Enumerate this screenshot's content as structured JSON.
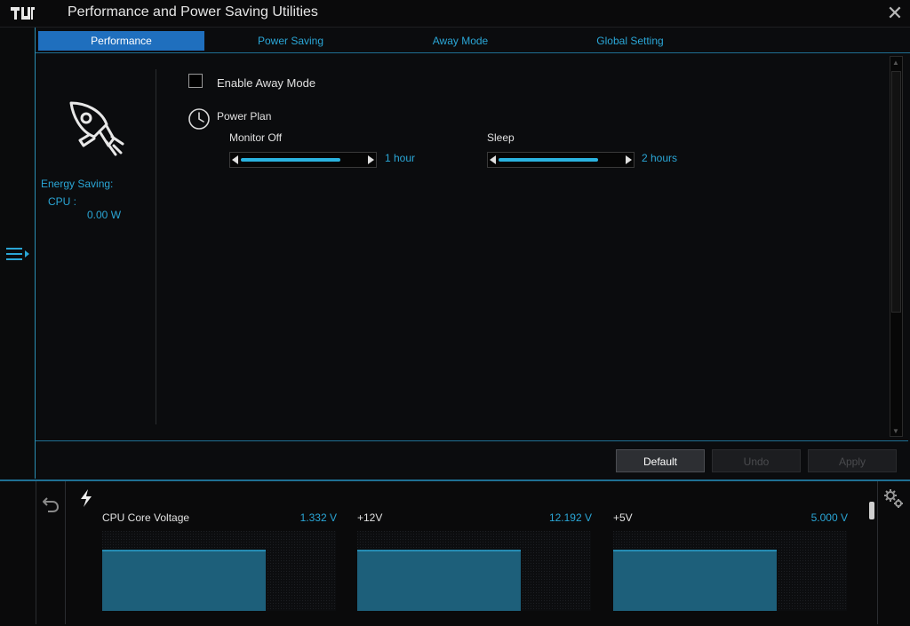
{
  "window": {
    "title": "Performance and Power Saving Utilities",
    "close_icon": "close-icon",
    "logo_icon": "tuf-logo-icon"
  },
  "tabs": [
    {
      "label": "Performance",
      "active": true
    },
    {
      "label": "Power Saving",
      "active": false
    },
    {
      "label": "Away Mode",
      "active": false
    },
    {
      "label": "Global Setting",
      "active": false
    }
  ],
  "side_panel": {
    "icon": "rocket-icon",
    "energy_saving_label": "Energy Saving:",
    "cpu_label": "CPU :",
    "cpu_value": "0.00 W"
  },
  "away_mode": {
    "label": "Enable Away Mode",
    "checked": false
  },
  "power_plan": {
    "icon": "clock-icon",
    "label": "Power Plan",
    "monitor_off": {
      "label": "Monitor Off",
      "value": "1 hour",
      "level": 0.8
    },
    "sleep": {
      "label": "Sleep",
      "value": "2 hours",
      "level": 0.8
    }
  },
  "buttons": {
    "default": "Default",
    "undo": "Undo",
    "apply": "Apply"
  },
  "monitor": {
    "items": [
      {
        "name": "CPU Core Voltage",
        "value": "1.332 V",
        "fill": 0.7
      },
      {
        "name": "+12V",
        "value": "12.192 V",
        "fill": 0.7
      },
      {
        "name": "+5V",
        "value": "5.000 V",
        "fill": 0.7
      }
    ],
    "accent_color": "#2aa6d6",
    "graph_fill_color": "#1d5f7a"
  },
  "colors": {
    "accent": "#2aa6d6",
    "tab_active_bg": "#1f6fbe",
    "background": "#0b0c0e"
  }
}
